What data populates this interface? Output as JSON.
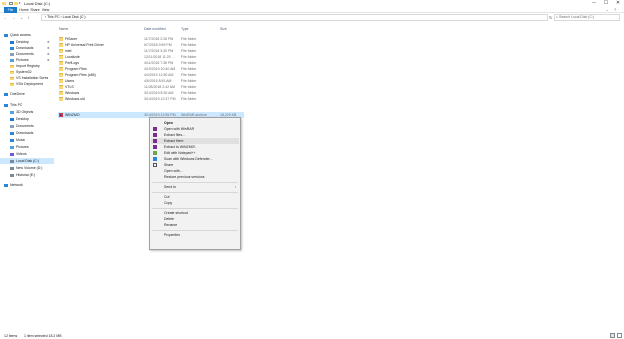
{
  "window": {
    "title": "Local Disk (C:)",
    "controls": {
      "minimize": "─",
      "maximize": "☐",
      "close": "✕"
    }
  },
  "ribbon": {
    "tabs": [
      "File",
      "Home",
      "Share",
      "View"
    ]
  },
  "address": {
    "back": "←",
    "forward": "→",
    "recent": "⌄",
    "up": "↑",
    "path": "›  This PC  ›  Local Disk (C:)",
    "search_placeholder": "Search Local Disk (C:)"
  },
  "nav": {
    "items": [
      {
        "label": "Quick access",
        "icon": "star-icon",
        "color": "#2b88d8"
      },
      {
        "label": "Desktop",
        "icon": "desktop-icon",
        "color": "#1e7ad6",
        "pinned": true
      },
      {
        "label": "Downloads",
        "icon": "download-icon",
        "color": "#2b88d8",
        "pinned": true
      },
      {
        "label": "Documents",
        "icon": "document-icon",
        "color": "#8aa0b8",
        "pinned": true
      },
      {
        "label": "Pictures",
        "icon": "pictures-icon",
        "color": "#5aa0d8",
        "pinned": true
      },
      {
        "label": "Import Registry",
        "icon": "folder-icon",
        "color": "#f8d775"
      },
      {
        "label": "System32",
        "icon": "folder-icon",
        "color": "#f8d775"
      },
      {
        "label": "VS Installation Scres",
        "icon": "folder-icon",
        "color": "#f8d775"
      },
      {
        "label": "VSix Deployment",
        "icon": "folder-icon",
        "color": "#f8d775"
      },
      {
        "label": "OneDrive",
        "icon": "cloud-icon",
        "color": "#2b88d8"
      },
      {
        "label": "This PC",
        "icon": "computer-icon",
        "color": "#2b88d8"
      },
      {
        "label": "3D Objects",
        "icon": "cube-icon",
        "color": "#5aa0d8"
      },
      {
        "label": "Desktop",
        "icon": "desktop-icon",
        "color": "#1e7ad6"
      },
      {
        "label": "Documents",
        "icon": "document-icon",
        "color": "#8aa0b8"
      },
      {
        "label": "Downloads",
        "icon": "download-icon",
        "color": "#2b88d8"
      },
      {
        "label": "Music",
        "icon": "music-icon",
        "color": "#2b88d8"
      },
      {
        "label": "Pictures",
        "icon": "pictures-icon",
        "color": "#5aa0d8"
      },
      {
        "label": "Videos",
        "icon": "video-icon",
        "color": "#6d5ad8"
      },
      {
        "label": "Local Disk (C:)",
        "icon": "drive-icon",
        "color": "#7a8a99",
        "selected": true
      },
      {
        "label": "New Volume (D:)",
        "icon": "drive-icon",
        "color": "#7a8a99"
      },
      {
        "label": "Historial (E:)",
        "icon": "drive-icon",
        "color": "#7a8a99"
      },
      {
        "label": "Network",
        "icon": "network-icon",
        "color": "#2b88d8"
      }
    ]
  },
  "files": {
    "columns": {
      "name": "Name",
      "date": "Date modified",
      "type": "Type",
      "size": "Size"
    },
    "rows": [
      {
        "name": "FtSaver",
        "date": "11/7/2018 2:26 PM",
        "type": "File folder",
        "size": ""
      },
      {
        "name": "HP Universal Print Driver",
        "date": "9/7/2018 9:59 PM",
        "type": "File folder",
        "size": ""
      },
      {
        "name": "intel",
        "date": "11/7/2018 3:30 PM",
        "type": "File folder",
        "size": ""
      },
      {
        "name": "Localizde",
        "date": "12/11/2018 11:20 ...",
        "type": "File folder",
        "size": ""
      },
      {
        "name": "PerfLogs",
        "date": "4/11/2018 7:38 PM",
        "type": "File folder",
        "size": ""
      },
      {
        "name": "Program Files",
        "date": "4/19/2019 10:40 AM",
        "type": "File folder",
        "size": ""
      },
      {
        "name": "Program Files (x86)",
        "date": "4/4/2019 12:50 AM",
        "type": "File folder",
        "size": ""
      },
      {
        "name": "Users",
        "date": "4/5/2019 8:53 AM",
        "type": "File folder",
        "size": ""
      },
      {
        "name": "VTLS",
        "date": "11/28/2018 2:42 AM",
        "type": "File folder",
        "size": ""
      },
      {
        "name": "Windows",
        "date": "3/14/2019 8:30 AM",
        "type": "File folder",
        "size": ""
      },
      {
        "name": "Windows.old",
        "date": "3/14/2019 12:37 PM",
        "type": "File folder",
        "size": ""
      },
      {
        "name": "WINZMO",
        "date": "3/14/2019 12:55 PM",
        "type": "WinRAR archive",
        "size": "18,229 KB",
        "selected": true
      }
    ]
  },
  "context_menu": {
    "items": [
      {
        "label": "Open",
        "bold": true,
        "icon": ""
      },
      {
        "label": "Open with WinRAR",
        "icon": "winrar-icon"
      },
      {
        "label": "Extract files...",
        "icon": "winrar-icon"
      },
      {
        "label": "Extract Here",
        "icon": "winrar-icon",
        "hover": true
      },
      {
        "label": "Extract to WINZMO\\",
        "icon": "winrar-icon"
      },
      {
        "label": "Edit with Notepad++",
        "icon": "notepad-icon"
      },
      {
        "label": "Scan with Windows Defender...",
        "icon": "defender-icon"
      },
      {
        "label": "Share",
        "icon": "share-icon"
      },
      {
        "label": "Open with...",
        "icon": ""
      },
      {
        "label": "Restore previous versions",
        "icon": ""
      },
      {
        "sep": true
      },
      {
        "label": "Send to",
        "icon": "",
        "submenu": true
      },
      {
        "sep": true
      },
      {
        "label": "Cut",
        "icon": ""
      },
      {
        "label": "Copy",
        "icon": ""
      },
      {
        "sep": true
      },
      {
        "label": "Create shortcut",
        "icon": ""
      },
      {
        "label": "Delete",
        "icon": ""
      },
      {
        "label": "Rename",
        "icon": ""
      },
      {
        "sep": true
      },
      {
        "label": "Properties",
        "icon": ""
      }
    ],
    "submenu_arrow": "›"
  },
  "status": {
    "items_count": "12 items",
    "selection": "1 item selected  18.2 MB"
  },
  "colors": {
    "accent": "#1979ca",
    "selection": "#cce8ff",
    "folder": "#f8d775"
  }
}
